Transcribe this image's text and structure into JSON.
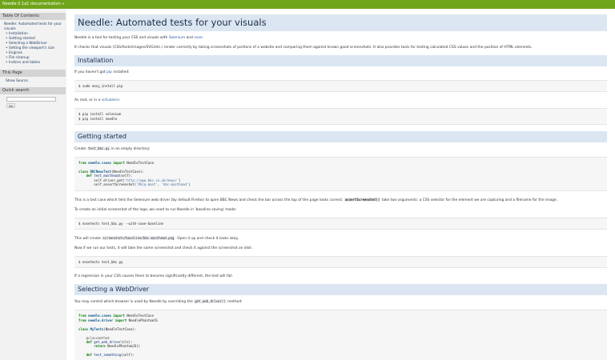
{
  "topbar": {
    "doc_link": "Needle 0.1a1 documentation »"
  },
  "sidebar": {
    "toc_heading": "Table Of Contents",
    "toc_root_line1": "Needle: Automated tests for your",
    "toc_root_line2": "visuals",
    "toc_items": [
      "Installation",
      "Getting started",
      "Selecting a WebDriver",
      "Setting the viewport's size",
      "Engines",
      "File cleanup",
      "Indices and tables"
    ],
    "this_page_heading": "This Page",
    "show_source": "Show Source",
    "quick_search_heading": "Quick search",
    "search_placeholder": "",
    "go_label": "Go"
  },
  "main": {
    "title": "Needle: Automated tests for your visuals",
    "intro": {
      "p1_a": "Needle is a tool for testing your CSS and visuals with ",
      "p1_link1": "Selenium",
      "p1_b": " and ",
      "p1_link2": "nose",
      "p1_c": ".",
      "p2": "It checks that visuals (CSS/fonts/images/SVG/etc.) render correctly by taking screenshots of portions of a website and comparing them against known good screenshots. It also provides tools for testing calculated CSS values and the position of HTML elements."
    },
    "installation": {
      "heading": "Installation",
      "p1_a": "If you haven't got ",
      "p1_link": "pip",
      "p1_b": " installed:",
      "code1": "$ sudo easy_install pip",
      "p2_a": "As root, or in a ",
      "p2_link": "virtualenv",
      "p2_b": ":",
      "code2_l1": "$ pip install selenium",
      "code2_l2": "$ pip install needle"
    },
    "getting_started": {
      "heading": "Getting started",
      "p1_a": "Create ",
      "p1_code": "test_bbc.py",
      "p1_b": " in an empty directory:",
      "code": {
        "l1_kw1": "from",
        "l1_mod": "needle.cases",
        "l1_kw2": "import",
        "l1_rest": "NeedleTestCase",
        "l2_kw": "class",
        "l2_cls": "BBCNewsTest",
        "l2_rest": "(NeedleTestCase):",
        "l3_kw": "def",
        "l3_fn": "test_masthead",
        "l3_rest": "(self):",
        "l4_a": "self.driver.get(",
        "l4_str": "'http://www.bbc.co.uk/news/'",
        "l4_b": ")",
        "l5_a": "self.assertScreenshot(",
        "l5_s1": "'#blq-mast'",
        "l5_b": ", ",
        "l5_s2": "'bbc-masthead'",
        "l5_c": ")"
      },
      "p2_a": "This is a test case which tells the Selenium web driver (by default Firefox) to open BBC News and check the bar across the top of the page looks correct. ",
      "p2_code": "assertScreenshot()",
      "p2_b": " take two arguments: a CSS selector for the element we are capturing and a filename for the image.",
      "p3": "To create an initial screenshot of the logo, we need to run Needle in 'baseline saving' mode:",
      "code2": "$ nosetests test_bbc.py --with-save-baseline",
      "p4_a": "This will create ",
      "p4_code": "screenshots/baseline/bbc-masthead.png",
      "p4_b": ". Open it up and check it looks okay.",
      "p5": "Now if we run our tests, it will take the same screenshot and check it against the screenshot on disk:",
      "code3": "$ nosetests test_bbc.py",
      "p6": "If a regression in your CSS causes them to become significantly different, the test will fail."
    },
    "webdriver": {
      "heading": "Selecting a WebDriver",
      "p1_a": "You may control which browser is used by Needle by overriding the ",
      "p1_code": "get_web_driver()",
      "p1_b": " method:",
      "code": {
        "l1_kw1": "from",
        "l1_mod": "needle.cases",
        "l1_kw2": "import",
        "l1_rest": "NeedleTestCase",
        "l2_kw1": "from",
        "l2_mod": "needle.driver",
        "l2_kw2": "import",
        "l2_rest": "NeedlePhantomJS",
        "l3_kw": "class",
        "l3_cls": "MyTests",
        "l3_rest": "(NeedleTestCase):",
        "l4_dec": "@classmethod",
        "l5_kw": "def",
        "l5_fn": "get_web_driver",
        "l5_rest": "(cls):",
        "l6_kw": "return",
        "l6_rest": "NeedlePhantomJS()",
        "l7_kw": "def",
        "l7_fn": "test_something",
        "l7_rest": "(self):"
      }
    }
  }
}
